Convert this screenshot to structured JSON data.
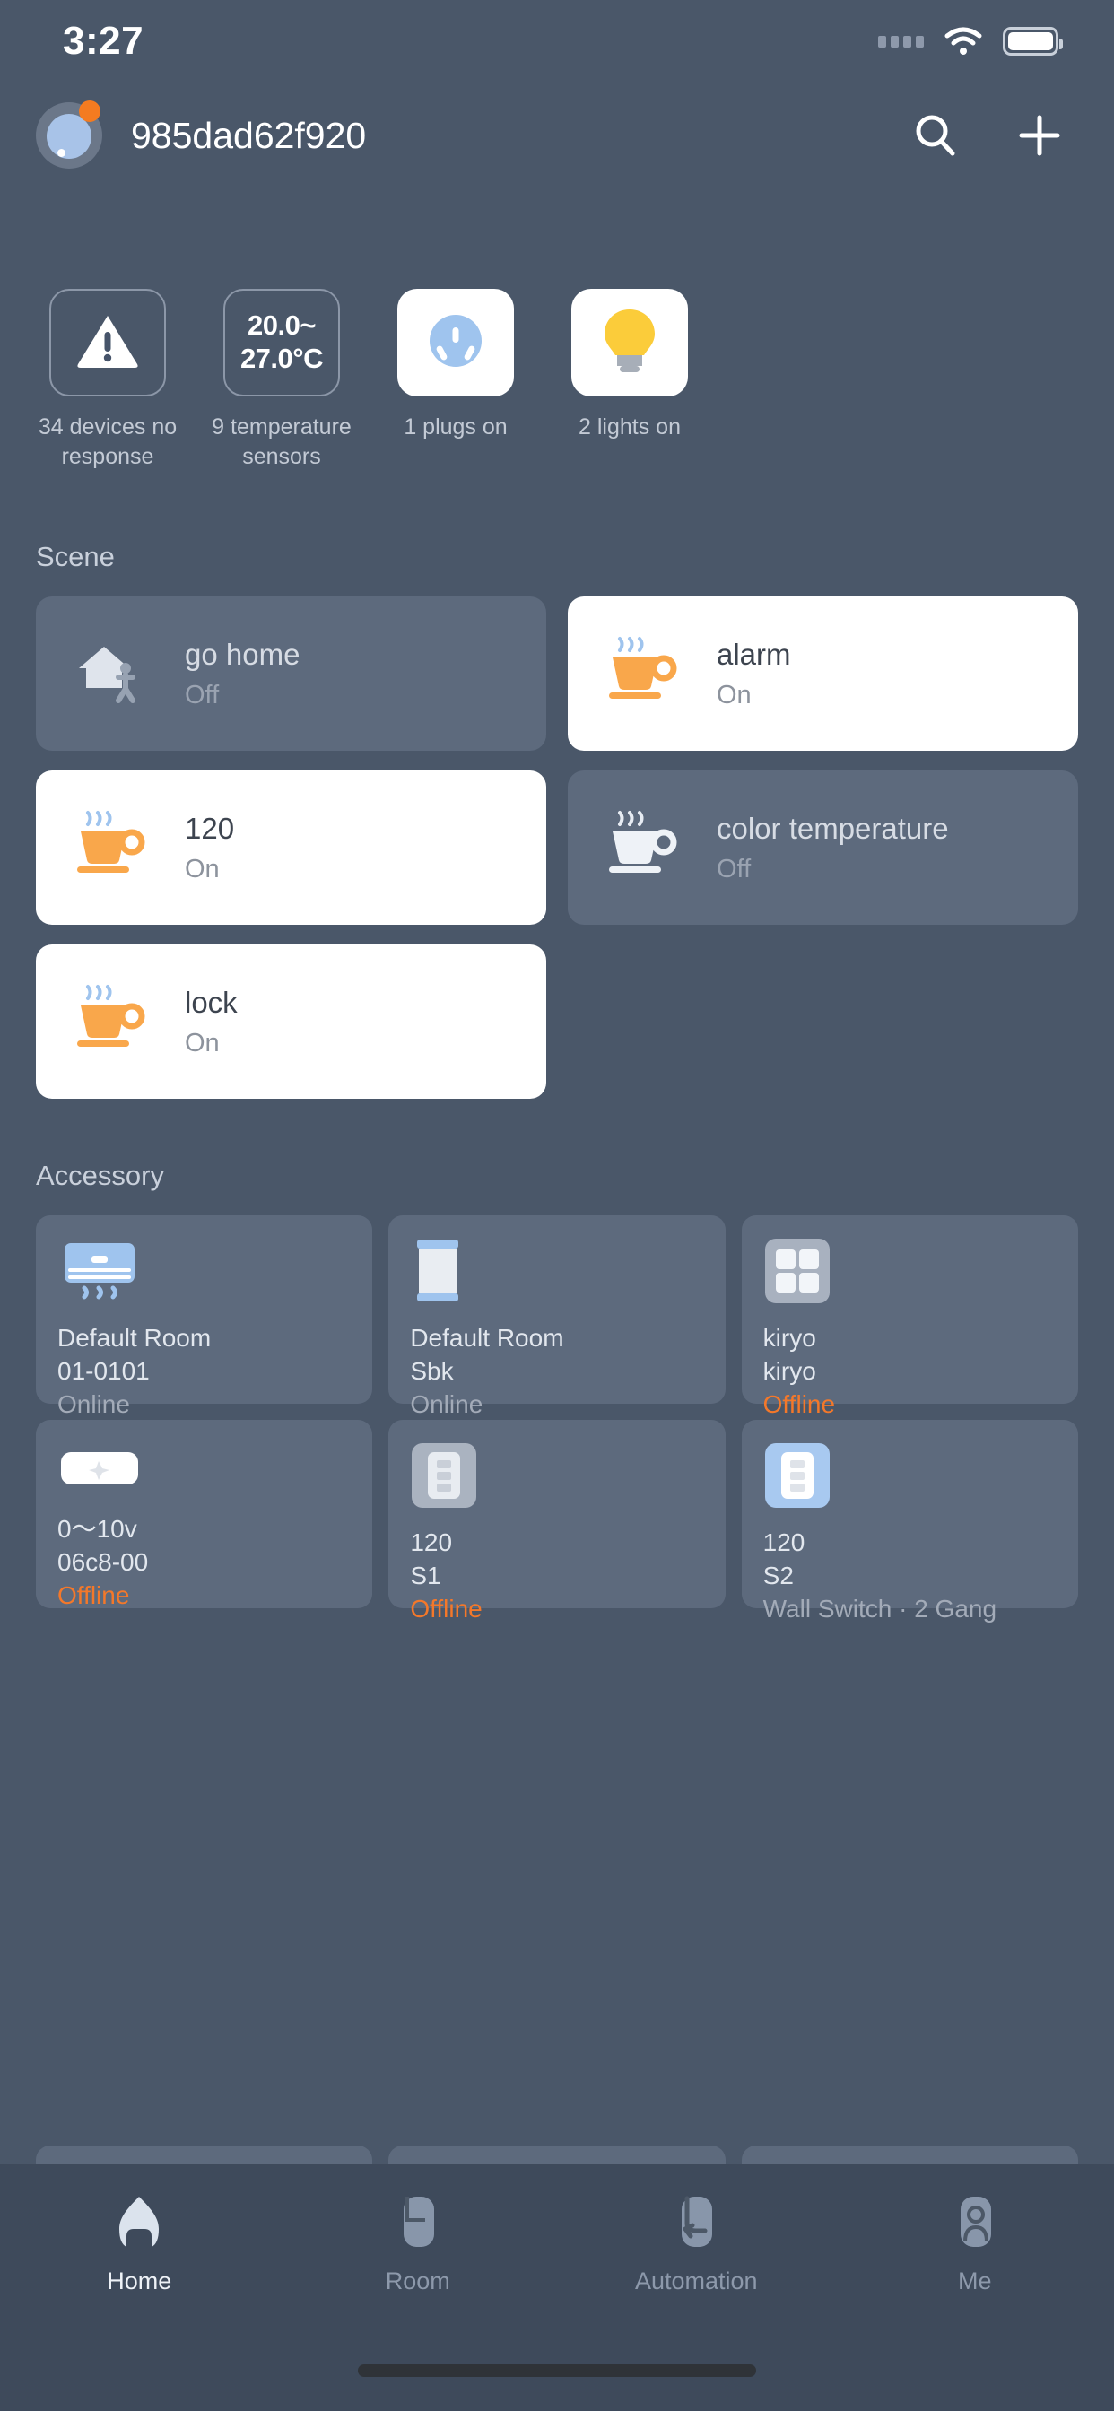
{
  "status_bar": {
    "time": "3:27",
    "signal_icon": "signal-dots-icon",
    "wifi_icon": "wifi-icon",
    "battery_icon": "battery-full-icon"
  },
  "header": {
    "home_name": "985dad62f920",
    "avatar_icon": "avatar",
    "notification_badge": true,
    "search_icon": "search-icon",
    "add_icon": "plus-icon"
  },
  "summary_tiles": [
    {
      "icon": "warning-triangle-icon",
      "value": "",
      "label": "34 devices no response",
      "style": "outline"
    },
    {
      "icon": "temperature-value",
      "value": "20.0~\n27.0°C",
      "label": "9 temperature sensors",
      "style": "outline"
    },
    {
      "icon": "power-plug-icon",
      "value": "",
      "label": "1 plugs on",
      "style": "filled"
    },
    {
      "icon": "light-bulb-icon",
      "value": "",
      "label": "2 lights on",
      "style": "filled"
    }
  ],
  "scene": {
    "title": "Scene",
    "items": [
      {
        "name": "go home",
        "state": "Off",
        "icon": "house-person-icon",
        "active": false
      },
      {
        "name": "alarm",
        "state": "On",
        "icon": "coffee-cup-icon",
        "active": true
      },
      {
        "name": "120",
        "state": "On",
        "icon": "coffee-cup-icon",
        "active": true
      },
      {
        "name": "color temperature",
        "state": "Off",
        "icon": "coffee-cup-icon",
        "active": false
      },
      {
        "name": "lock",
        "state": "On",
        "icon": "coffee-cup-icon",
        "active": true
      }
    ]
  },
  "accessory": {
    "title": "Accessory",
    "items": [
      {
        "line1": "Default Room",
        "line2": "01-0101",
        "status": "Online",
        "offline": false,
        "icon": "air-conditioner-icon"
      },
      {
        "line1": "Default Room",
        "line2": "Sbk",
        "status": "Online",
        "offline": false,
        "icon": "curtain-icon"
      },
      {
        "line1": "kiryo",
        "line2": "kiryo",
        "status": "Offline",
        "offline": true,
        "icon": "four-gang-switch-icon"
      },
      {
        "line1": "0～10v",
        "line2": "06c8-00",
        "status": "Offline",
        "offline": true,
        "icon": "dimmer-module-icon"
      },
      {
        "line1": "120",
        "line2": "S1",
        "status": "Offline",
        "offline": true,
        "icon": "wall-switch-gray-icon"
      },
      {
        "line1": "120",
        "line2": "S2",
        "status": "Wall Switch · 2 Gang",
        "offline": false,
        "icon": "wall-switch-blue-icon"
      }
    ]
  },
  "tabbar": {
    "items": [
      {
        "label": "Home",
        "icon": "home-icon",
        "active": true
      },
      {
        "label": "Room",
        "icon": "room-icon",
        "active": false
      },
      {
        "label": "Automation",
        "icon": "automation-icon",
        "active": false
      },
      {
        "label": "Me",
        "icon": "person-icon",
        "active": false
      }
    ]
  },
  "colors": {
    "background": "#4a5769",
    "card_off": "#5d6a7d",
    "card_on": "#ffffff",
    "accent_orange": "#f4782a",
    "tabbar": "#3e4a5b"
  }
}
